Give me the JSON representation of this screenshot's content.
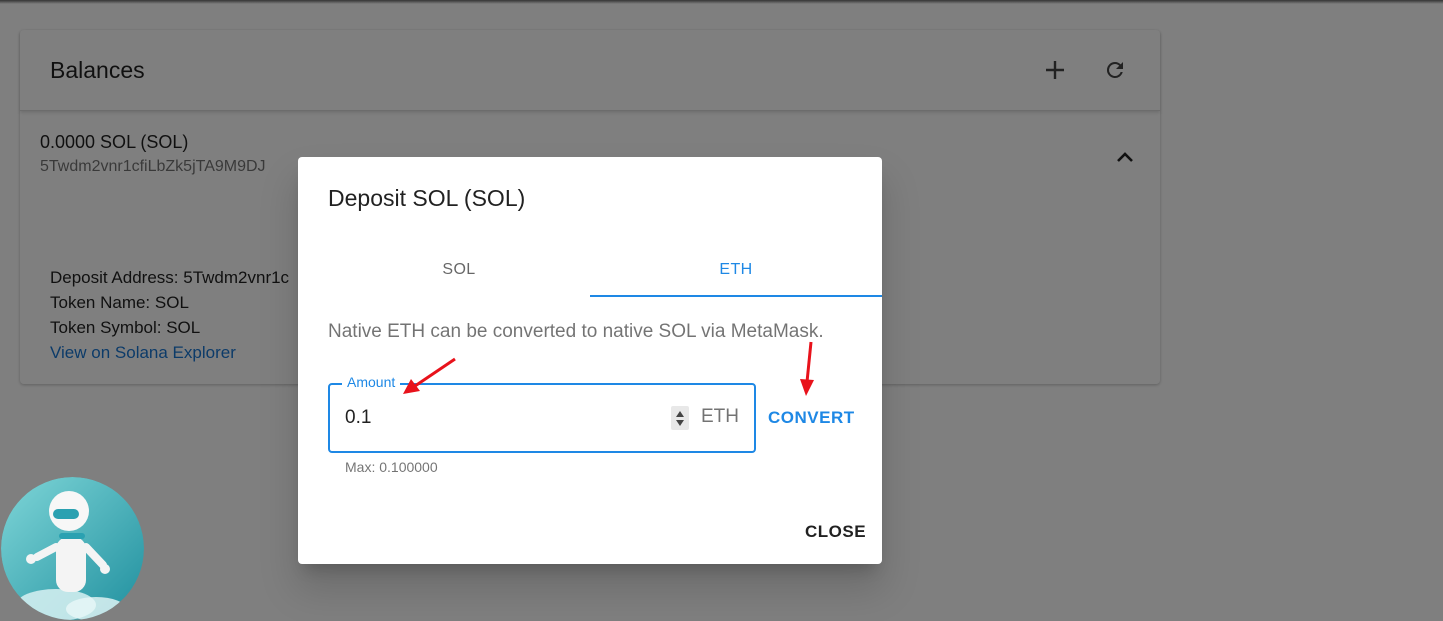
{
  "balances_card": {
    "title": "Balances",
    "add_icon": "plus-icon",
    "refresh_icon": "refresh-icon",
    "account": {
      "amount_label": "0.0000 SOL (SOL)",
      "address_truncated": "5Twdm2vnr1cfiLbZk5jTA9M9DJ",
      "expand_icon": "chevron-up-icon",
      "deposit_address": "Deposit Address: 5Twdm2vnr1c",
      "token_name": "Token Name: SOL",
      "token_symbol": "Token Symbol: SOL",
      "explorer_link": "View on Solana Explorer"
    }
  },
  "dialog": {
    "title": "Deposit SOL (SOL)",
    "tabs": [
      {
        "label": "SOL",
        "selected": false
      },
      {
        "label": "ETH",
        "selected": true
      }
    ],
    "description": "Native ETH can be converted to native SOL via MetaMask.",
    "amount_field": {
      "label": "Amount",
      "value": "0.1",
      "suffix": "ETH",
      "helper": "Max: 0.100000"
    },
    "convert_label": "CONVERT",
    "close_label": "CLOSE"
  },
  "colors": {
    "accent": "#1e88e5",
    "link": "#1976d2",
    "annotation_arrow": "#e8121b"
  }
}
